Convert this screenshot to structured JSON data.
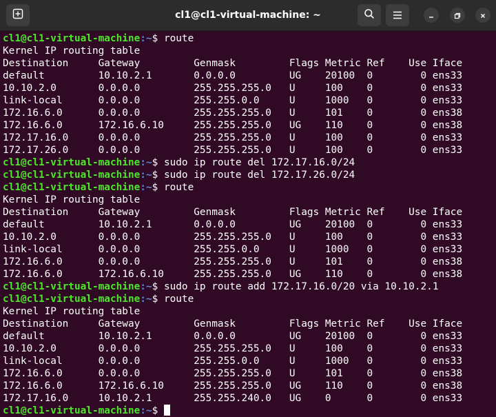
{
  "window": {
    "title": "cl1@cl1-virtual-machine: ~"
  },
  "icons": {
    "new_tab": "new-tab-icon",
    "search": "search-icon",
    "menu": "hamburger-menu-icon",
    "minimize": "minimize-icon",
    "maximize": "maximize-icon",
    "close": "close-icon"
  },
  "colors": {
    "background": "#300a24",
    "prompt_user": "#4ee62b",
    "prompt_path": "#5b8bd6",
    "text": "#ffffff",
    "titlebar": "#2c2c2c"
  },
  "prompt": {
    "user": "cl1@cl1-virtual-machine",
    "path": ":~",
    "symbol": "$ "
  },
  "lines": [
    {
      "type": "prompt",
      "cmd": "route"
    },
    {
      "type": "out",
      "text": "Kernel IP routing table"
    },
    {
      "type": "out",
      "text": "Destination     Gateway         Genmask         Flags Metric Ref    Use Iface"
    },
    {
      "type": "out",
      "text": "default         10.10.2.1       0.0.0.0         UG    20100  0        0 ens33"
    },
    {
      "type": "out",
      "text": "10.10.2.0       0.0.0.0         255.255.255.0   U     100    0        0 ens33"
    },
    {
      "type": "out",
      "text": "link-local      0.0.0.0         255.255.0.0     U     1000   0        0 ens33"
    },
    {
      "type": "out",
      "text": "172.16.6.0      0.0.0.0         255.255.255.0   U     101    0        0 ens38"
    },
    {
      "type": "out",
      "text": "172.16.6.0      172.16.6.10     255.255.255.0   UG    110    0        0 ens38"
    },
    {
      "type": "out",
      "text": "172.17.16.0     0.0.0.0         255.255.255.0   U     100    0        0 ens33"
    },
    {
      "type": "out",
      "text": "172.17.26.0     0.0.0.0         255.255.255.0   U     100    0        0 ens33"
    },
    {
      "type": "prompt",
      "cmd": "sudo ip route del 172.17.16.0/24"
    },
    {
      "type": "prompt",
      "cmd": "sudo ip route del 172.17.26.0/24"
    },
    {
      "type": "prompt",
      "cmd": "route"
    },
    {
      "type": "out",
      "text": "Kernel IP routing table"
    },
    {
      "type": "out",
      "text": "Destination     Gateway         Genmask         Flags Metric Ref    Use Iface"
    },
    {
      "type": "out",
      "text": "default         10.10.2.1       0.0.0.0         UG    20100  0        0 ens33"
    },
    {
      "type": "out",
      "text": "10.10.2.0       0.0.0.0         255.255.255.0   U     100    0        0 ens33"
    },
    {
      "type": "out",
      "text": "link-local      0.0.0.0         255.255.0.0     U     1000   0        0 ens33"
    },
    {
      "type": "out",
      "text": "172.16.6.0      0.0.0.0         255.255.255.0   U     101    0        0 ens38"
    },
    {
      "type": "out",
      "text": "172.16.6.0      172.16.6.10     255.255.255.0   UG    110    0        0 ens38"
    },
    {
      "type": "prompt",
      "cmd": "sudo ip route add 172.17.16.0/20 via 10.10.2.1"
    },
    {
      "type": "prompt",
      "cmd": "route"
    },
    {
      "type": "out",
      "text": "Kernel IP routing table"
    },
    {
      "type": "out",
      "text": "Destination     Gateway         Genmask         Flags Metric Ref    Use Iface"
    },
    {
      "type": "out",
      "text": "default         10.10.2.1       0.0.0.0         UG    20100  0        0 ens33"
    },
    {
      "type": "out",
      "text": "10.10.2.0       0.0.0.0         255.255.255.0   U     100    0        0 ens33"
    },
    {
      "type": "out",
      "text": "link-local      0.0.0.0         255.255.0.0     U     1000   0        0 ens33"
    },
    {
      "type": "out",
      "text": "172.16.6.0      0.0.0.0         255.255.255.0   U     101    0        0 ens38"
    },
    {
      "type": "out",
      "text": "172.16.6.0      172.16.6.10     255.255.255.0   UG    110    0        0 ens38"
    },
    {
      "type": "out",
      "text": "172.17.16.0     10.10.2.1       255.255.240.0   UG    0      0        0 ens33"
    },
    {
      "type": "prompt",
      "cmd": "",
      "cursor": true
    }
  ]
}
